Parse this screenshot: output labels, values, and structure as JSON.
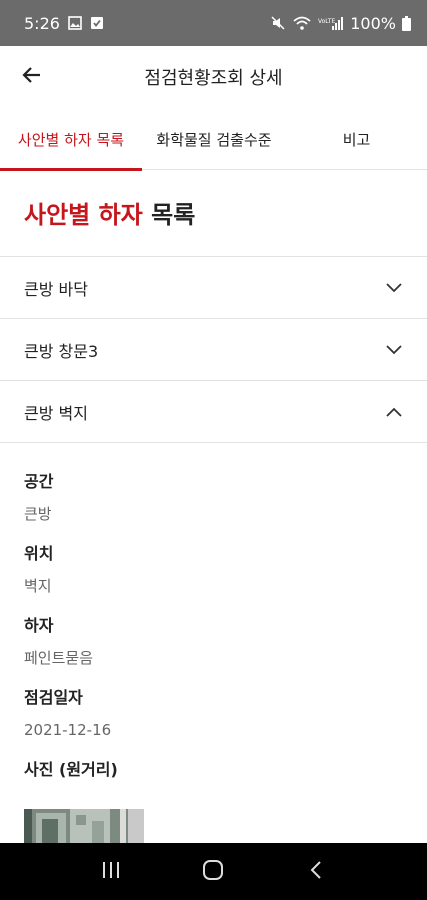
{
  "status_bar": {
    "time": "5:26",
    "battery": "100%",
    "icons": [
      "gallery-icon",
      "check-icon",
      "mute-icon",
      "wifi-icon",
      "signal-icon",
      "battery-icon"
    ]
  },
  "header": {
    "title": "점검현황조회 상세",
    "back_icon": "arrow-left-icon"
  },
  "tabs": [
    {
      "label": "사안별 하자 목록",
      "active": true
    },
    {
      "label": "화학물질 검출수준",
      "active": false
    },
    {
      "label": "비고",
      "active": false
    }
  ],
  "section": {
    "title_highlight": "사안별 하자",
    "title_rest": " 목록"
  },
  "accordion": [
    {
      "label": "큰방 바닥",
      "expanded": false
    },
    {
      "label": "큰방 창문3",
      "expanded": false
    },
    {
      "label": "큰방 벽지",
      "expanded": true
    }
  ],
  "details": {
    "space_label": "공간",
    "space_value": "큰방",
    "location_label": "위치",
    "location_value": "벽지",
    "defect_label": "하자",
    "defect_value": "페인트묻음",
    "date_label": "점검일자",
    "date_value": "2021-12-16",
    "photo_label": "사진 (원거리)"
  },
  "colors": {
    "accent": "#c4161c",
    "status_bar": "#6b6b6b",
    "nav_bar": "#000000"
  },
  "nav_bar": {
    "icons": [
      "recent-apps-icon",
      "home-icon",
      "back-icon"
    ]
  }
}
